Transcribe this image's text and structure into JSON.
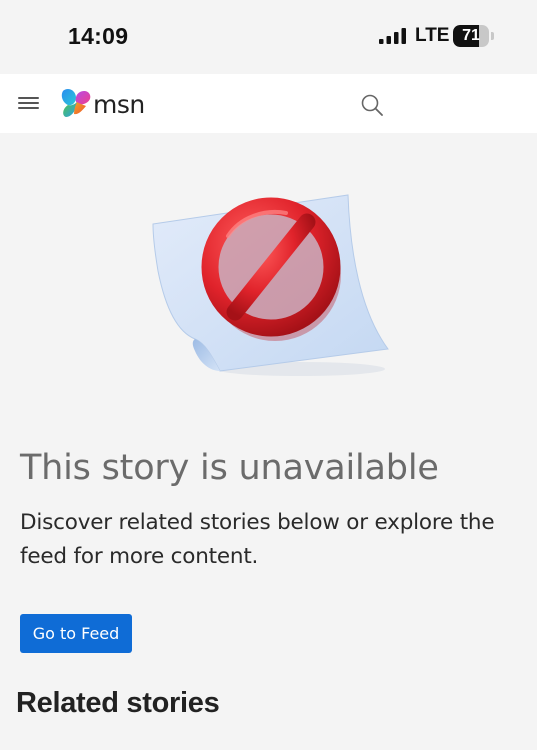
{
  "status_bar": {
    "time": "14:09",
    "network": "LTE",
    "battery_level": "71",
    "battery_fraction": 0.71
  },
  "header": {
    "logo_text": "msn",
    "icons": [
      "menu-icon",
      "msn-logo-icon",
      "search-icon"
    ]
  },
  "error": {
    "illustration": "prohibited-sign-on-paper-icon",
    "title": "This story is unavailable",
    "message": "Discover related stories below or explore the feed for more content.",
    "button_label": "Go to Feed"
  },
  "related": {
    "heading": "Related stories"
  },
  "colors": {
    "accent": "#0f6cd6",
    "prohibited_red": "#e0232b",
    "background": "#f4f4f4"
  }
}
